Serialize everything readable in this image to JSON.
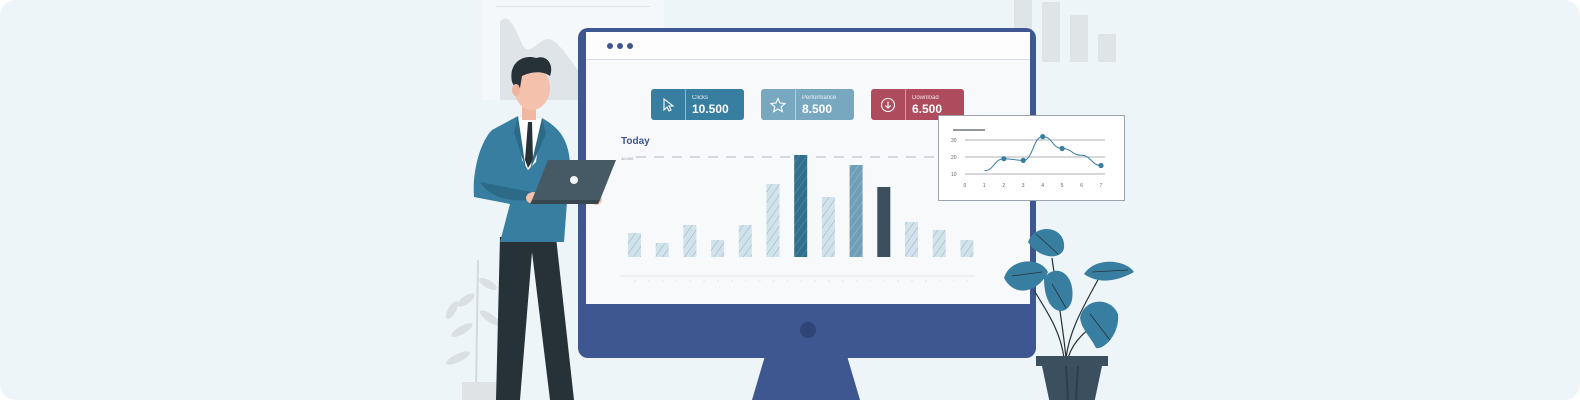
{
  "dashboard": {
    "cards": [
      {
        "label": "Clicks",
        "value": "10.500",
        "icon": "cursor-icon",
        "color": "#387ea1"
      },
      {
        "label": "Performance",
        "value": "8.500",
        "icon": "star-icon",
        "color": "#78a8c0"
      },
      {
        "label": "Download",
        "value": "6.500",
        "icon": "download-icon",
        "color": "#ae4b5d"
      }
    ],
    "chart_title": "Today",
    "reference_label": "10.000"
  },
  "chart_data": [
    {
      "type": "bar",
      "title": "Today",
      "categories": [
        "",
        "",
        "",
        "",
        "",
        "",
        "",
        "",
        "",
        "",
        "",
        "",
        "",
        "",
        "",
        "",
        "",
        "",
        "",
        "",
        "",
        "",
        "",
        "",
        "",
        "",
        ""
      ],
      "values": [
        2400,
        1400,
        3200,
        1700,
        3200,
        7300,
        10200,
        6000,
        9200,
        7000,
        3500,
        2700,
        1700
      ],
      "ylim": [
        0,
        10500
      ],
      "reference_line": 10000,
      "highlight_colors": [
        "#ccdde7",
        "#ccdde7",
        "#ccdde7",
        "#ccdde7",
        "#ccdde7",
        "#ccdde7",
        "#326f8c",
        "#ccdde7",
        "#6fa0b8",
        "#3b4f5e",
        "#ccdde7",
        "#ccdde7",
        "#ccdde7"
      ]
    },
    {
      "type": "line",
      "x": [
        1,
        2,
        3,
        4,
        5,
        6,
        7
      ],
      "y_ticks": [
        "10",
        "20",
        "30"
      ],
      "x_ticks": [
        "0",
        "1",
        "2",
        "3",
        "4",
        "5",
        "6",
        "7"
      ],
      "points": [
        [
          1,
          12
        ],
        [
          2,
          19
        ],
        [
          3,
          18
        ],
        [
          4,
          32
        ],
        [
          5,
          25
        ],
        [
          6,
          21
        ],
        [
          7,
          15
        ]
      ],
      "color": "#387ea1"
    }
  ]
}
